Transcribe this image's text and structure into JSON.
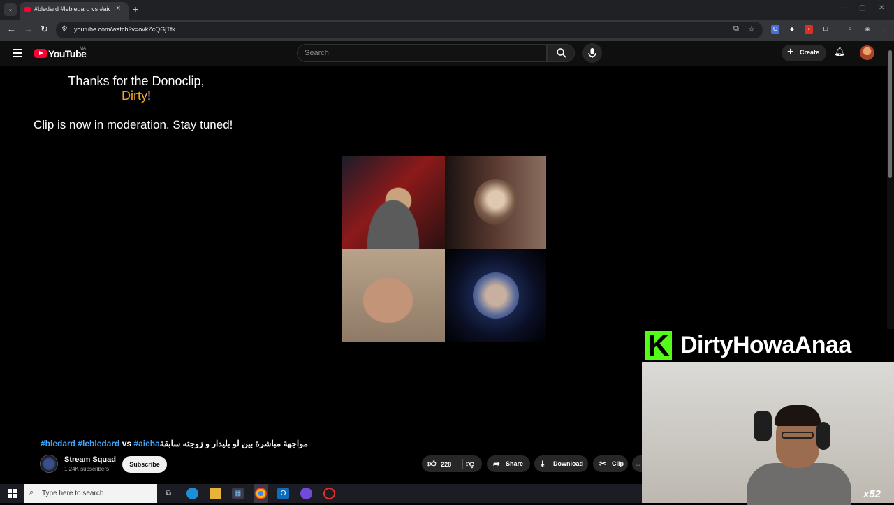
{
  "browser": {
    "tab_dropdown": "⌄",
    "tab_title": "#bledard #lebledard vs #aicha",
    "tab_close": "×",
    "new_tab": "+",
    "win_min": "—",
    "win_max": "▢",
    "win_close": "✕",
    "url": "youtube.com/watch?v=ovkZcQGjTfk"
  },
  "youtube": {
    "logo_text": "YouTube",
    "country_code": "MA",
    "search_placeholder": "Search",
    "create_label": "Create"
  },
  "video_overlay": {
    "thanks_line": "Thanks for the Donoclip,",
    "donor_name": "Dirty",
    "donor_suffix": "!",
    "moderation_text": "Clip is now in moderation. Stay tuned!"
  },
  "stream_overlay": {
    "streamer_name": "DirtyHowaAnaa",
    "multiplier": "x52",
    "accent_color": "#53fc18"
  },
  "video": {
    "tags": [
      "#bledard",
      "#lebledard",
      "vs",
      "#aicha"
    ],
    "arabic_title": "مواجهة مباشرة بين لو بليدار و زوجته سابقة",
    "channel_name": "Stream Squad",
    "subscribers": "1.24K subscribers",
    "subscribe_label": "Subscribe",
    "like_count": "228",
    "share_label": "Share",
    "download_label": "Download",
    "clip_label": "Clip"
  },
  "taskbar": {
    "search_placeholder": "Type here to search"
  }
}
